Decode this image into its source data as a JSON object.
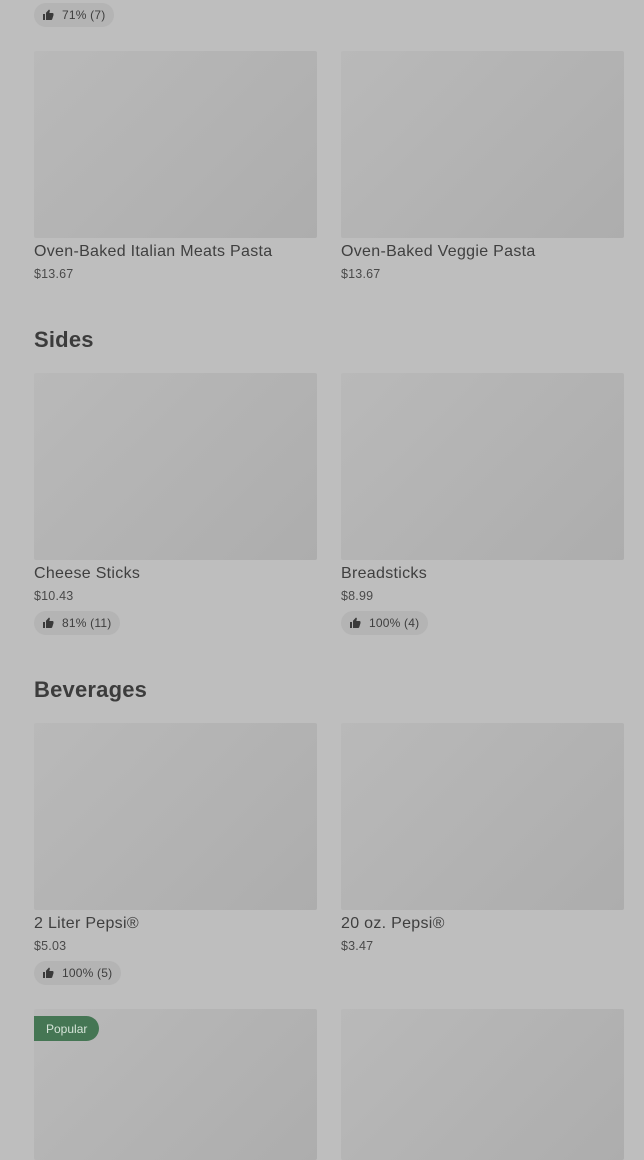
{
  "top_rating": {
    "text": "71% (7)"
  },
  "pasta": {
    "items": [
      {
        "name": "Oven-Baked Italian Meats Pasta",
        "price": "$13.67"
      },
      {
        "name": "Oven-Baked Veggie Pasta",
        "price": "$13.67"
      }
    ]
  },
  "sides": {
    "title": "Sides",
    "items": [
      {
        "name": "Cheese Sticks",
        "price": "$10.43",
        "rating": "81% (11)"
      },
      {
        "name": "Breadsticks",
        "price": "$8.99",
        "rating": "100% (4)"
      }
    ]
  },
  "beverages": {
    "title": "Beverages",
    "items": [
      {
        "name": "2 Liter Pepsi®",
        "price": "$5.03",
        "rating": "100% (5)"
      },
      {
        "name": "20 oz. Pepsi®",
        "price": "$3.47"
      }
    ],
    "popular_label": "Popular"
  },
  "icons": {
    "rating": "thumbs-up-icon"
  },
  "colors": {
    "popular_badge": "#457654",
    "rating_badge": "#b4b4b4"
  }
}
